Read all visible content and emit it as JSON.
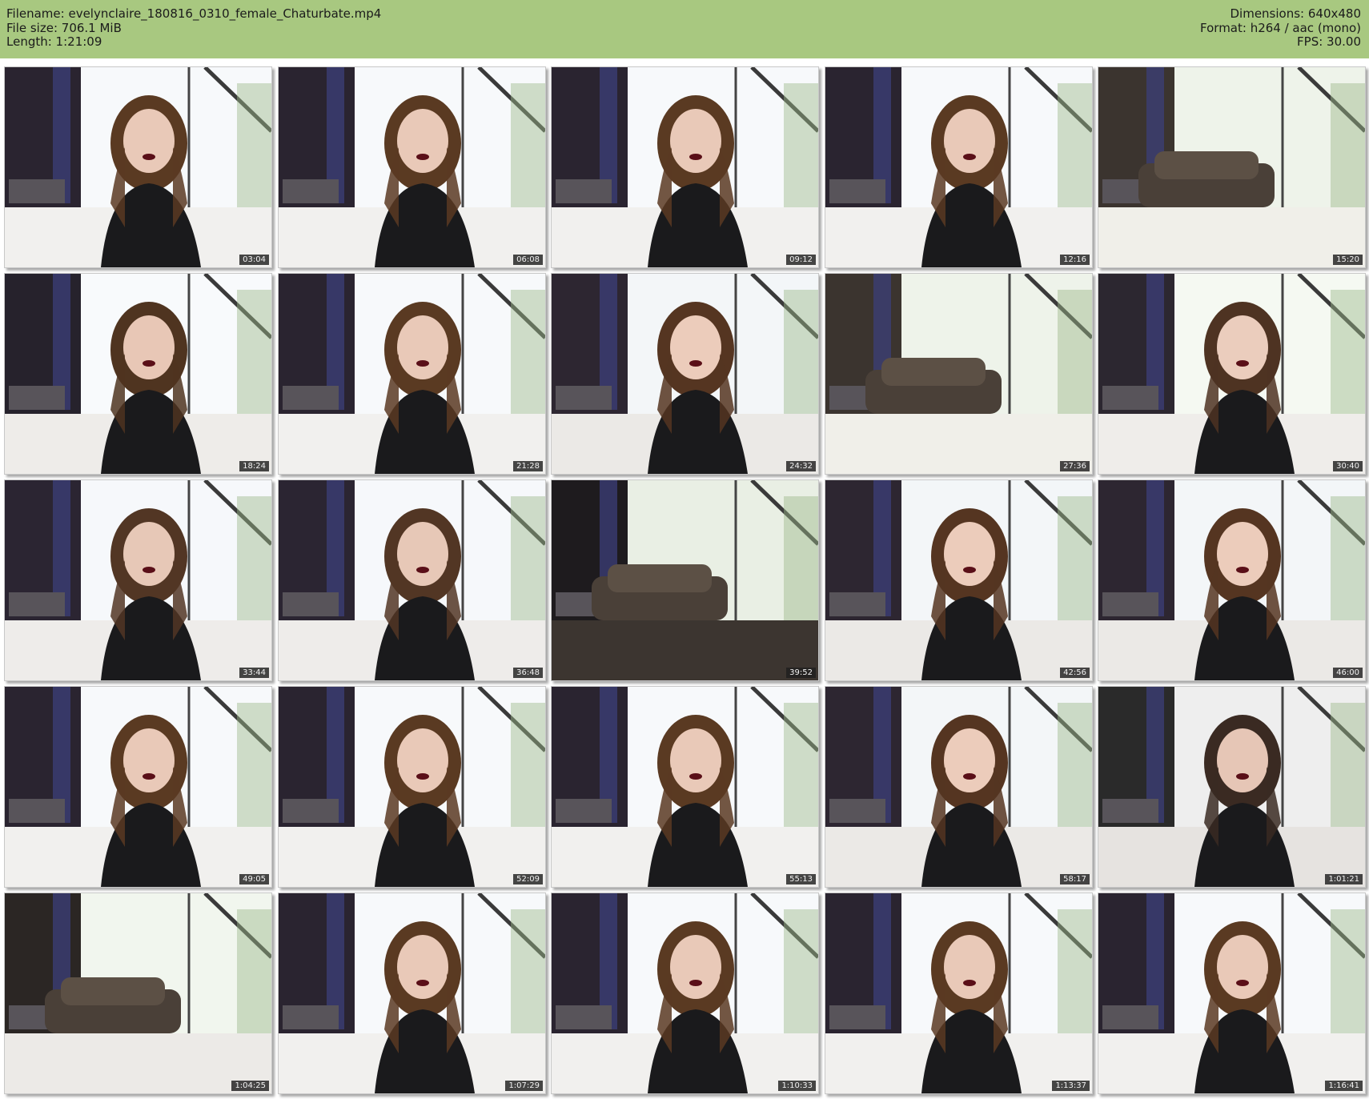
{
  "header": {
    "filename": "Filename: evelynclaire_180816_0310_female_Chaturbate.mp4",
    "filesize": "File size: 706.1 MiB",
    "length": "Length: 1:21:09",
    "dimensions": "Dimensions: 640x480",
    "format": "Format: h264 / aac (mono)",
    "fps": "FPS: 30.00"
  },
  "thumbnails": [
    {
      "time": "03:04",
      "scene": "woman-lying-on-bed"
    },
    {
      "time": "06:08",
      "scene": "woman-lying-on-bed"
    },
    {
      "time": "09:12",
      "scene": "woman-lying-on-bed"
    },
    {
      "time": "12:16",
      "scene": "woman-lying-on-bed"
    },
    {
      "time": "15:20",
      "scene": "empty-bed-by-window"
    },
    {
      "time": "18:24",
      "scene": "woman-on-bed"
    },
    {
      "time": "21:28",
      "scene": "woman-lying-on-bed"
    },
    {
      "time": "24:32",
      "scene": "woman-close-up"
    },
    {
      "time": "27:36",
      "scene": "empty-bed-by-window"
    },
    {
      "time": "30:40",
      "scene": "woman-sitting-by-window"
    },
    {
      "time": "33:44",
      "scene": "woman-sitting-on-bed"
    },
    {
      "time": "36:48",
      "scene": "woman-sitting-on-bed"
    },
    {
      "time": "39:52",
      "scene": "empty-room-window"
    },
    {
      "time": "42:56",
      "scene": "woman-close-up"
    },
    {
      "time": "46:00",
      "scene": "woman-close-up"
    },
    {
      "time": "49:05",
      "scene": "woman-lying-on-bed"
    },
    {
      "time": "52:09",
      "scene": "woman-lying-on-bed"
    },
    {
      "time": "55:13",
      "scene": "woman-lying-on-bed"
    },
    {
      "time": "58:17",
      "scene": "woman-close-up"
    },
    {
      "time": "1:01:21",
      "scene": "close-up-by-window"
    },
    {
      "time": "1:04:25",
      "scene": "bed-by-window"
    },
    {
      "time": "1:07:29",
      "scene": "woman-lying-on-bed"
    },
    {
      "time": "1:10:33",
      "scene": "woman-lying-on-bed"
    },
    {
      "time": "1:13:37",
      "scene": "woman-lying-on-bed"
    },
    {
      "time": "1:16:41",
      "scene": "woman-lying-on-bed"
    }
  ]
}
